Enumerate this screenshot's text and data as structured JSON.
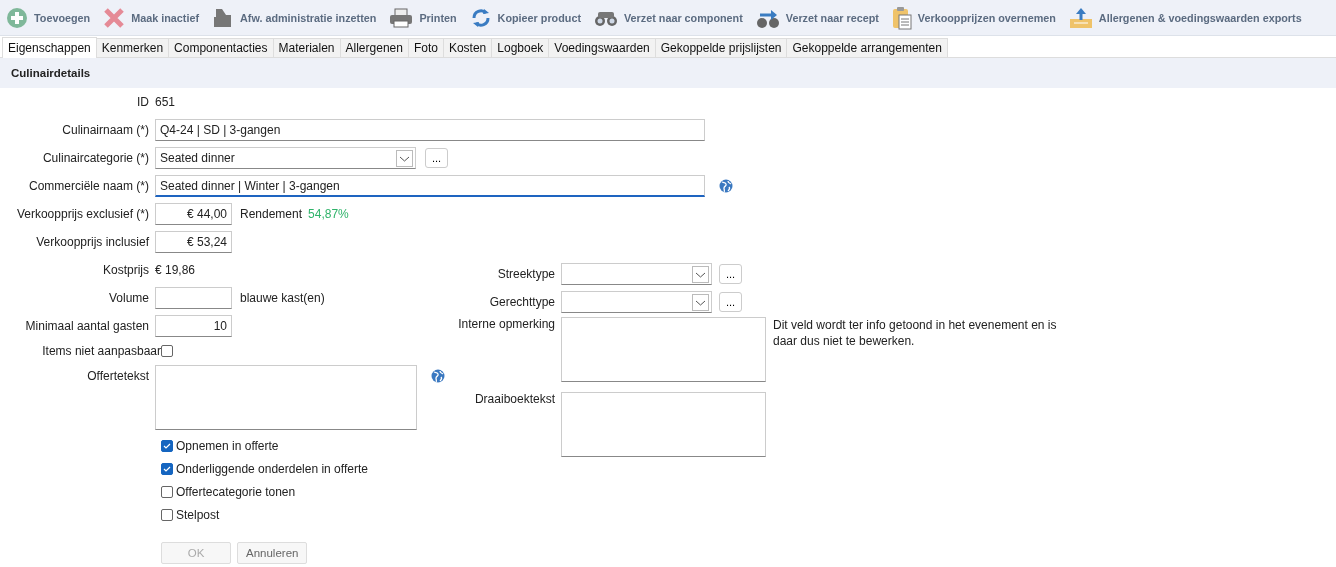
{
  "toolbar": [
    {
      "label": "Toevoegen",
      "kind": "plus"
    },
    {
      "label": "Maak inactief",
      "kind": "cross"
    },
    {
      "label": "Afw. administratie inzetten",
      "kind": "register"
    },
    {
      "label": "Printen",
      "kind": "printer"
    },
    {
      "label": "Kopieer product",
      "kind": "refresh"
    },
    {
      "label": "Verzet naar component",
      "kind": "binoculars"
    },
    {
      "label": "Verzet naar recept",
      "kind": "binoculars-arrow"
    },
    {
      "label": "Verkoopprijzen overnemen",
      "kind": "clipboard"
    },
    {
      "label": "Allergenen & voedingswaarden exports",
      "kind": "upload"
    }
  ],
  "tabs": [
    {
      "label": "Eigenschappen",
      "selected": true
    },
    {
      "label": "Kenmerken",
      "selected": false
    },
    {
      "label": "Componentacties",
      "selected": false
    },
    {
      "label": "Materialen",
      "selected": false
    },
    {
      "label": "Allergenen",
      "selected": false
    },
    {
      "label": "Foto",
      "selected": false
    },
    {
      "label": "Kosten",
      "selected": false
    },
    {
      "label": "Logboek",
      "selected": false
    },
    {
      "label": "Voedingswaarden",
      "selected": false
    },
    {
      "label": "Gekoppelde prijslijsten",
      "selected": false
    },
    {
      "label": "Gekoppelde arrangementen",
      "selected": false
    }
  ],
  "section": {
    "title": "Culinairdetails"
  },
  "id": {
    "label": "ID",
    "value": "651"
  },
  "culinairnaam": {
    "label": "Culinairnaam (*)",
    "value": "Q4-24 | SD | 3-gangen"
  },
  "culinaircategorie": {
    "label": "Culinaircategorie (*)",
    "value": "Seated dinner",
    "button": "..."
  },
  "commerciele_naam": {
    "label": "Commerciële naam (*)",
    "value": "Seated dinner | Winter | 3-gangen",
    "focused": true
  },
  "verkoopprijs_exclusief": {
    "label": "Verkoopprijs exclusief (*)",
    "value": "€ 44,00"
  },
  "rendement": {
    "label": "Rendement",
    "value": "54,87%"
  },
  "verkoopprijs_inclusief": {
    "label": "Verkoopprijs inclusief",
    "value": "€ 53,24"
  },
  "kostprijs": {
    "label": "Kostprijs",
    "value": "€ 19,86"
  },
  "volume": {
    "label": "Volume",
    "unit": "blauwe kast(en)"
  },
  "minimaal_aantal_gasten": {
    "label": "Minimaal aantal gasten",
    "value": "10"
  },
  "items_niet_aanpasbaar": {
    "label": "Items niet aanpasbaar",
    "checked": false
  },
  "offertetekst": {
    "label": "Offertetekst"
  },
  "checkboxes": [
    {
      "label": "Opnemen in offerte",
      "checked": true
    },
    {
      "label": "Onderliggende onderdelen in offerte",
      "checked": true
    },
    {
      "label": "Offertecategorie tonen",
      "checked": false
    },
    {
      "label": "Stelpost",
      "checked": false
    }
  ],
  "streektype": {
    "label": "Streektype",
    "button": "..."
  },
  "gerechttype": {
    "label": "Gerechttype",
    "button": "..."
  },
  "interne_opmerking": {
    "label": "Interne opmerking",
    "note": "Dit veld wordt ter info getoond in het evenement en is daar dus niet te bewerken."
  },
  "draaiboektekst": {
    "label": "Draaiboektekst"
  },
  "buttons": [
    {
      "label": "OK",
      "disabled": true
    },
    {
      "label": "Annuleren",
      "disabled": false
    }
  ]
}
